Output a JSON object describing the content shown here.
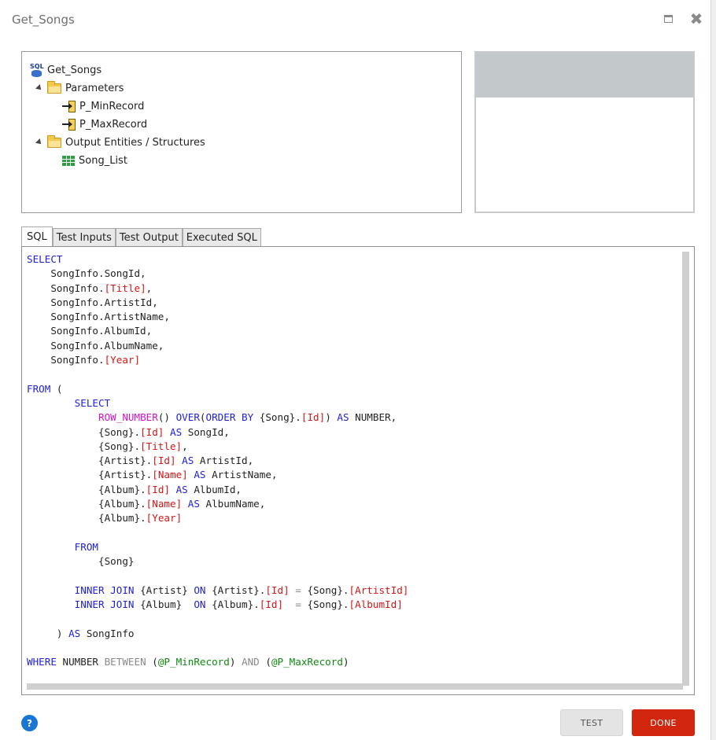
{
  "window": {
    "title": "Get_Songs",
    "maximize_icon": "maximize-icon",
    "close_icon": "close-icon",
    "close_glyph": "✖"
  },
  "tree": {
    "root": "Get_Songs",
    "parameters_label": "Parameters",
    "parameters": [
      "P_MinRecord",
      "P_MaxRecord"
    ],
    "outputs_label": "Output Entities / Structures",
    "outputs": [
      "Song_List"
    ]
  },
  "tabs": [
    "SQL",
    "Test Inputs",
    "Test Output",
    "Executed SQL"
  ],
  "active_tab": "SQL",
  "sql_lines": [
    [
      [
        "kw",
        "SELECT"
      ]
    ],
    [
      [
        "t",
        "    SongInfo.SongId,"
      ]
    ],
    [
      [
        "t",
        "    SongInfo."
      ],
      [
        "br",
        "[Title]"
      ],
      [
        "t",
        ","
      ]
    ],
    [
      [
        "t",
        "    SongInfo.ArtistId,"
      ]
    ],
    [
      [
        "t",
        "    SongInfo.ArtistName,"
      ]
    ],
    [
      [
        "t",
        "    SongInfo.AlbumId,"
      ]
    ],
    [
      [
        "t",
        "    SongInfo.AlbumName,"
      ]
    ],
    [
      [
        "t",
        "    SongInfo."
      ],
      [
        "br",
        "[Year]"
      ]
    ],
    [],
    [
      [
        "kw",
        "FROM"
      ],
      [
        "t",
        " ("
      ]
    ],
    [
      [
        "t",
        "        "
      ],
      [
        "kw",
        "SELECT"
      ]
    ],
    [
      [
        "t",
        "            "
      ],
      [
        "fn",
        "ROW_NUMBER"
      ],
      [
        "t",
        "() "
      ],
      [
        "kw",
        "OVER"
      ],
      [
        "t",
        "("
      ],
      [
        "kw",
        "ORDER BY"
      ],
      [
        "t",
        " {Song}."
      ],
      [
        "br",
        "[Id]"
      ],
      [
        "t",
        ") "
      ],
      [
        "kw",
        "AS"
      ],
      [
        "t",
        " NUMBER,"
      ]
    ],
    [
      [
        "t",
        "            {Song}."
      ],
      [
        "br",
        "[Id]"
      ],
      [
        "t",
        " "
      ],
      [
        "kw",
        "AS"
      ],
      [
        "t",
        " SongId,"
      ]
    ],
    [
      [
        "t",
        "            {Song}."
      ],
      [
        "br",
        "[Title]"
      ],
      [
        "t",
        ","
      ]
    ],
    [
      [
        "t",
        "            {Artist}."
      ],
      [
        "br",
        "[Id]"
      ],
      [
        "t",
        " "
      ],
      [
        "kw",
        "AS"
      ],
      [
        "t",
        " ArtistId,"
      ]
    ],
    [
      [
        "t",
        "            {Artist}."
      ],
      [
        "br",
        "[Name]"
      ],
      [
        "t",
        " "
      ],
      [
        "kw",
        "AS"
      ],
      [
        "t",
        " ArtistName,"
      ]
    ],
    [
      [
        "t",
        "            {Album}."
      ],
      [
        "br",
        "[Id]"
      ],
      [
        "t",
        " "
      ],
      [
        "kw",
        "AS"
      ],
      [
        "t",
        " AlbumId,"
      ]
    ],
    [
      [
        "t",
        "            {Album}."
      ],
      [
        "br",
        "[Name]"
      ],
      [
        "t",
        " "
      ],
      [
        "kw",
        "AS"
      ],
      [
        "t",
        " AlbumName,"
      ]
    ],
    [
      [
        "t",
        "            {Album}."
      ],
      [
        "br",
        "[Year]"
      ]
    ],
    [],
    [
      [
        "t",
        "        "
      ],
      [
        "kw",
        "FROM"
      ]
    ],
    [
      [
        "t",
        "            {Song}"
      ]
    ],
    [],
    [
      [
        "t",
        "        "
      ],
      [
        "kw",
        "INNER JOIN"
      ],
      [
        "t",
        " {Artist} "
      ],
      [
        "kw",
        "ON"
      ],
      [
        "t",
        " {Artist}."
      ],
      [
        "br",
        "[Id]"
      ],
      [
        "t",
        " "
      ],
      [
        "op",
        "="
      ],
      [
        "t",
        " {Song}."
      ],
      [
        "br",
        "[ArtistId]"
      ]
    ],
    [
      [
        "t",
        "        "
      ],
      [
        "kw",
        "INNER JOIN"
      ],
      [
        "t",
        " {Album}  "
      ],
      [
        "kw",
        "ON"
      ],
      [
        "t",
        " {Album}."
      ],
      [
        "br",
        "[Id]"
      ],
      [
        "t",
        "  "
      ],
      [
        "op",
        "="
      ],
      [
        "t",
        " {Song}."
      ],
      [
        "br",
        "[AlbumId]"
      ]
    ],
    [],
    [
      [
        "t",
        "     ) "
      ],
      [
        "kw",
        "AS"
      ],
      [
        "t",
        " SongInfo"
      ]
    ],
    [],
    [
      [
        "kw",
        "WHERE"
      ],
      [
        "t",
        " NUMBER "
      ],
      [
        "op",
        "BETWEEN"
      ],
      [
        "t",
        " ("
      ],
      [
        "pm",
        "@P_MinRecord"
      ],
      [
        "t",
        ") "
      ],
      [
        "op",
        "AND"
      ],
      [
        "t",
        " ("
      ],
      [
        "pm",
        "@P_MaxRecord"
      ],
      [
        "t",
        ")"
      ]
    ]
  ],
  "footer": {
    "help_label": "?",
    "test_label": "TEST",
    "done_label": "DONE"
  },
  "colors": {
    "keyword": "#1f22d8",
    "bracket_identifier": "#d31616",
    "function": "#d414c8",
    "parameter": "#0f8a0f",
    "operator": "#8a8a8a",
    "done_button": "#d3260e",
    "help_button": "#1976d2"
  }
}
